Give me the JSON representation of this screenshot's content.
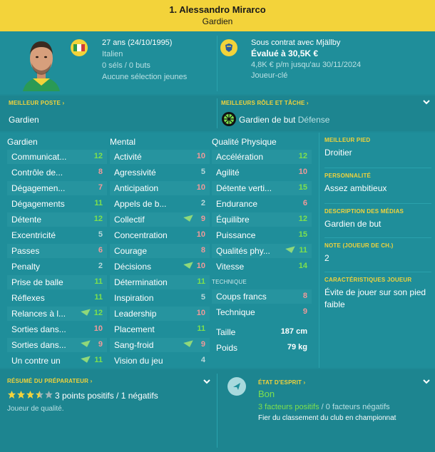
{
  "header": {
    "name": "1. Alessandro Mirarco",
    "position": "Gardien"
  },
  "profile": {
    "age_line": "27 ans (24/10/1995)",
    "nationality": "Italien",
    "caps": "0 séls / 0 buts",
    "youth": "Aucune sélection jeunes",
    "contract": "Sous contrat avec Mjällby",
    "value": "Évalué à 30,5K €",
    "wage": "4,8K € p/m jusqu'au 30/11/2024",
    "role": "Joueur-clé"
  },
  "best_position": {
    "label": "MEILLEUR POSTE",
    "value": "Gardien"
  },
  "best_role": {
    "label": "MEILLEURS RÔLE ET TÂCHE",
    "value": "Gardien de but",
    "duty": "Défense"
  },
  "columns": {
    "goalkeeper": "Gardien",
    "mental": "Mental",
    "physical": "Qualité Physique",
    "technique": "TECHNIQUE"
  },
  "gk_attrs": [
    {
      "name": "Communicat...",
      "value": "12",
      "color": "green",
      "flag": false
    },
    {
      "name": "Contrôle de...",
      "value": "8",
      "color": "red",
      "flag": false
    },
    {
      "name": "Dégagemen...",
      "value": "7",
      "color": "red",
      "flag": false
    },
    {
      "name": "Dégagements",
      "value": "11",
      "color": "green",
      "flag": false
    },
    {
      "name": "Détente",
      "value": "12",
      "color": "green",
      "flag": false
    },
    {
      "name": "Excentricité",
      "value": "5",
      "color": "grey",
      "flag": false
    },
    {
      "name": "Passes",
      "value": "6",
      "color": "red",
      "flag": false
    },
    {
      "name": "Penalty",
      "value": "2",
      "color": "grey",
      "flag": false
    },
    {
      "name": "Prise de balle",
      "value": "11",
      "color": "green",
      "flag": false
    },
    {
      "name": "Réflexes",
      "value": "11",
      "color": "green",
      "flag": false
    },
    {
      "name": "Relances à l...",
      "value": "12",
      "color": "green",
      "flag": true
    },
    {
      "name": "Sorties dans...",
      "value": "10",
      "color": "red",
      "flag": false
    },
    {
      "name": "Sorties dans...",
      "value": "9",
      "color": "red",
      "flag": true
    },
    {
      "name": "Un contre un",
      "value": "11",
      "color": "green",
      "flag": true
    }
  ],
  "mental_attrs": [
    {
      "name": "Activité",
      "value": "10",
      "color": "red",
      "flag": false
    },
    {
      "name": "Agressivité",
      "value": "5",
      "color": "grey",
      "flag": false
    },
    {
      "name": "Anticipation",
      "value": "10",
      "color": "red",
      "flag": false
    },
    {
      "name": "Appels de b...",
      "value": "2",
      "color": "grey",
      "flag": false
    },
    {
      "name": "Collectif",
      "value": "9",
      "color": "red",
      "flag": true
    },
    {
      "name": "Concentration",
      "value": "10",
      "color": "red",
      "flag": false
    },
    {
      "name": "Courage",
      "value": "8",
      "color": "red",
      "flag": false
    },
    {
      "name": "Décisions",
      "value": "10",
      "color": "red",
      "flag": true
    },
    {
      "name": "Détermination",
      "value": "11",
      "color": "green",
      "flag": false
    },
    {
      "name": "Inspiration",
      "value": "5",
      "color": "grey",
      "flag": false
    },
    {
      "name": "Leadership",
      "value": "10",
      "color": "red",
      "flag": false
    },
    {
      "name": "Placement",
      "value": "11",
      "color": "green",
      "flag": false
    },
    {
      "name": "Sang-froid",
      "value": "9",
      "color": "red",
      "flag": true
    },
    {
      "name": "Vision du jeu",
      "value": "4",
      "color": "grey",
      "flag": false
    }
  ],
  "physical_attrs": [
    {
      "name": "Accélération",
      "value": "12",
      "color": "green",
      "flag": false
    },
    {
      "name": "Agilité",
      "value": "10",
      "color": "red",
      "flag": false
    },
    {
      "name": "Détente verti...",
      "value": "15",
      "color": "green",
      "flag": false
    },
    {
      "name": "Endurance",
      "value": "6",
      "color": "red",
      "flag": false
    },
    {
      "name": "Équilibre",
      "value": "12",
      "color": "green",
      "flag": false
    },
    {
      "name": "Puissance",
      "value": "15",
      "color": "green",
      "flag": false
    },
    {
      "name": "Qualités phy...",
      "value": "11",
      "color": "green",
      "flag": true
    },
    {
      "name": "Vitesse",
      "value": "14",
      "color": "green",
      "flag": false
    }
  ],
  "technique_attrs": [
    {
      "name": "Coups francs",
      "value": "8",
      "color": "red",
      "flag": false
    },
    {
      "name": "Technique",
      "value": "9",
      "color": "red",
      "flag": false
    }
  ],
  "body": {
    "height_label": "Taille",
    "height": "187 cm",
    "weight_label": "Poids",
    "weight": "79 kg"
  },
  "right": [
    {
      "label": "MEILLEUR PIED",
      "value": "Droitier"
    },
    {
      "label": "PERSONNALITÉ",
      "value": "Assez ambitieux"
    },
    {
      "label": "DESCRIPTION DES MÉDIAS",
      "value": "Gardien de but"
    },
    {
      "label": "NOTE (JOUEUR DE CH.)",
      "value": "2"
    },
    {
      "label": "CARACTÉRISTIQUES JOUEUR",
      "value": "Évite de jouer sur son pied faible"
    }
  ],
  "coach": {
    "label": "RÉSUMÉ DU PRÉPARATEUR",
    "stars": 3.5,
    "points": "3 points positifs / 1 négatifs",
    "summary": "Joueur de qualité."
  },
  "mood": {
    "label": "ÉTAT D'ESPRIT",
    "value": "Bon",
    "positive": "3 facteurs positifs",
    "sep": "/",
    "negative": "0 facteurs négatifs",
    "note": "Fier du classement du club en championnat"
  },
  "colors": {
    "green": "#7de04d",
    "red": "#f09a9a",
    "grey": "#b8d7da",
    "accent": "#f3d33a"
  }
}
